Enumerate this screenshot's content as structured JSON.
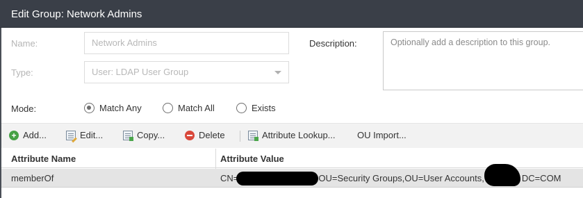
{
  "dialog": {
    "title": "Edit Group: Network Admins"
  },
  "form": {
    "name_label": "Name:",
    "name_value": "Network Admins",
    "type_label": "Type:",
    "type_value": "User: LDAP User Group",
    "description_label": "Description:",
    "description_placeholder": "Optionally add a description to this group.",
    "mode_label": "Mode:",
    "mode_options": [
      {
        "label": "Match Any",
        "checked": true
      },
      {
        "label": "Match All",
        "checked": false
      },
      {
        "label": "Exists",
        "checked": false
      }
    ]
  },
  "toolbar": {
    "add": "Add...",
    "edit": "Edit...",
    "copy": "Copy...",
    "delete": "Delete",
    "attribute_lookup": "Attribute Lookup...",
    "ou_import": "OU Import..."
  },
  "table": {
    "columns": [
      "Attribute Name",
      "Attribute Value"
    ],
    "rows": [
      {
        "name": "memberOf",
        "value_prefix": "CN=",
        "value_middle": "OU=Security Groups,OU=User Accounts,",
        "value_suffix": "DC=COM"
      }
    ]
  },
  "colors": {
    "titlebar": "#3a3f48",
    "add_icon": "#45a144",
    "delete_icon": "#d9483b",
    "selected_row": "#e4e4e4"
  }
}
